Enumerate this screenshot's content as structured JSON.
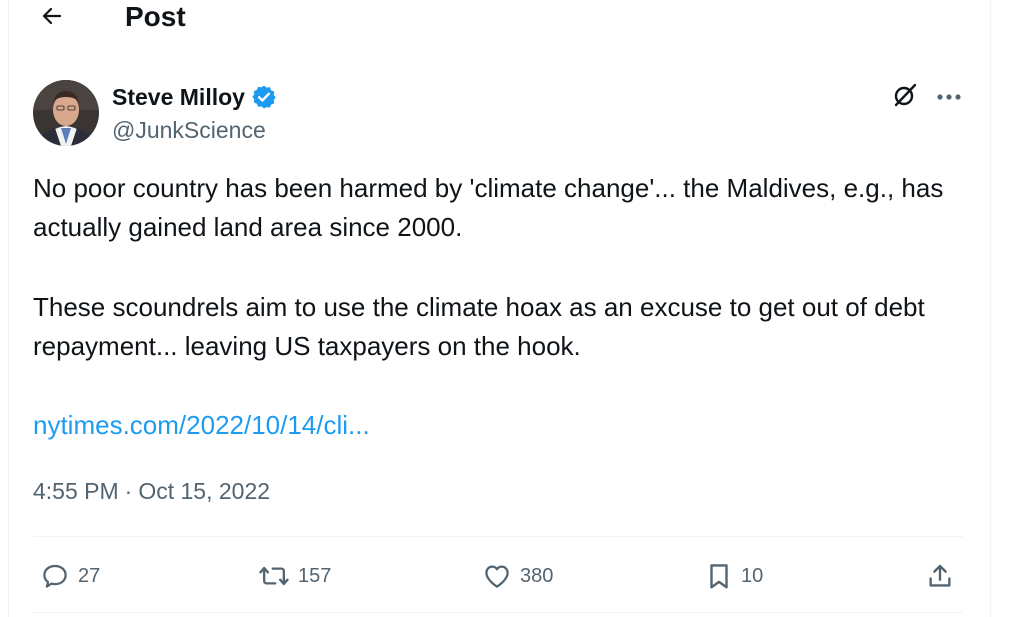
{
  "header": {
    "title": "Post"
  },
  "author": {
    "name": "Steve Milloy",
    "handle": "@JunkScience"
  },
  "tweet": {
    "paragraph1": "No poor country has been harmed by 'climate change'... the Maldives, e.g., has actually gained land area since 2000.",
    "paragraph2": "These scoundrels aim to use the climate hoax as an excuse to get out of debt repayment... leaving US taxpayers on the hook.",
    "link": "nytimes.com/2022/10/14/cli...",
    "time": "4:55 PM",
    "separator": "·",
    "date": "Oct 15, 2022"
  },
  "actions": {
    "replies": "27",
    "reposts": "157",
    "likes": "380",
    "bookmarks": "10"
  },
  "icons": {
    "back": "arrow-left-icon",
    "verified": "verified-badge-icon",
    "grok": "grok-icon",
    "more": "more-icon",
    "reply": "reply-icon",
    "repost": "repost-icon",
    "like": "heart-icon",
    "bookmark": "bookmark-icon",
    "share": "share-icon"
  },
  "colors": {
    "text": "#0f1419",
    "secondary": "#536471",
    "link": "#1d9bf0",
    "verified": "#1d9bf0",
    "divider": "#eff3f4"
  }
}
